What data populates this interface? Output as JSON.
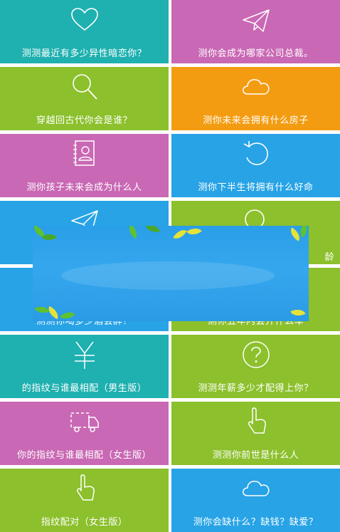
{
  "colors": {
    "teal": "#1fb0b0",
    "magenta": "#c968b4",
    "green": "#8cc02c",
    "orange": "#f39c11",
    "blue": "#27a3e6"
  },
  "tiles": [
    {
      "label": "测测最近有多少异性暗恋你？",
      "icon": "heart-icon",
      "color": "teal"
    },
    {
      "label": "测你会成为哪家公司总裁。",
      "icon": "paper-plane-icon",
      "color": "magenta"
    },
    {
      "label": "穿越回古代你会是谁？",
      "icon": "magnifier-icon",
      "color": "green"
    },
    {
      "label": "测你未来会拥有什么房子",
      "icon": "cloud-icon",
      "color": "orange"
    },
    {
      "label": "测你孩子未来会成为什么人",
      "icon": "contact-card-icon",
      "color": "magenta"
    },
    {
      "label": "测你下半生将拥有什么好命",
      "icon": "refresh-icon",
      "color": "blue"
    },
    {
      "label": "",
      "icon": "paper-plane-icon",
      "color": "blue"
    },
    {
      "label": "龄",
      "icon": "search-icon",
      "color": "green"
    },
    {
      "label": "测测你喝多少酒会醉？",
      "icon": "",
      "color": "blue"
    },
    {
      "label": "测你五年内会开什么车",
      "icon": "",
      "color": "green"
    },
    {
      "label": "的指纹与谁最相配（男生版）",
      "icon": "yen-icon",
      "color": "teal"
    },
    {
      "label": "测测年薪多少才配得上你？",
      "icon": "question-circle-icon",
      "color": "green"
    },
    {
      "label": "你的指纹与谁最相配（女生版）",
      "icon": "truck-icon",
      "color": "magenta"
    },
    {
      "label": "测测你前世是什么人",
      "icon": "pointing-hand-icon",
      "color": "green"
    },
    {
      "label": "指纹配对（女生版）",
      "icon": "pointing-hand-icon",
      "color": "green"
    },
    {
      "label": "测你会缺什么？缺钱？缺爱？",
      "icon": "cloud-icon",
      "color": "blue"
    }
  ]
}
